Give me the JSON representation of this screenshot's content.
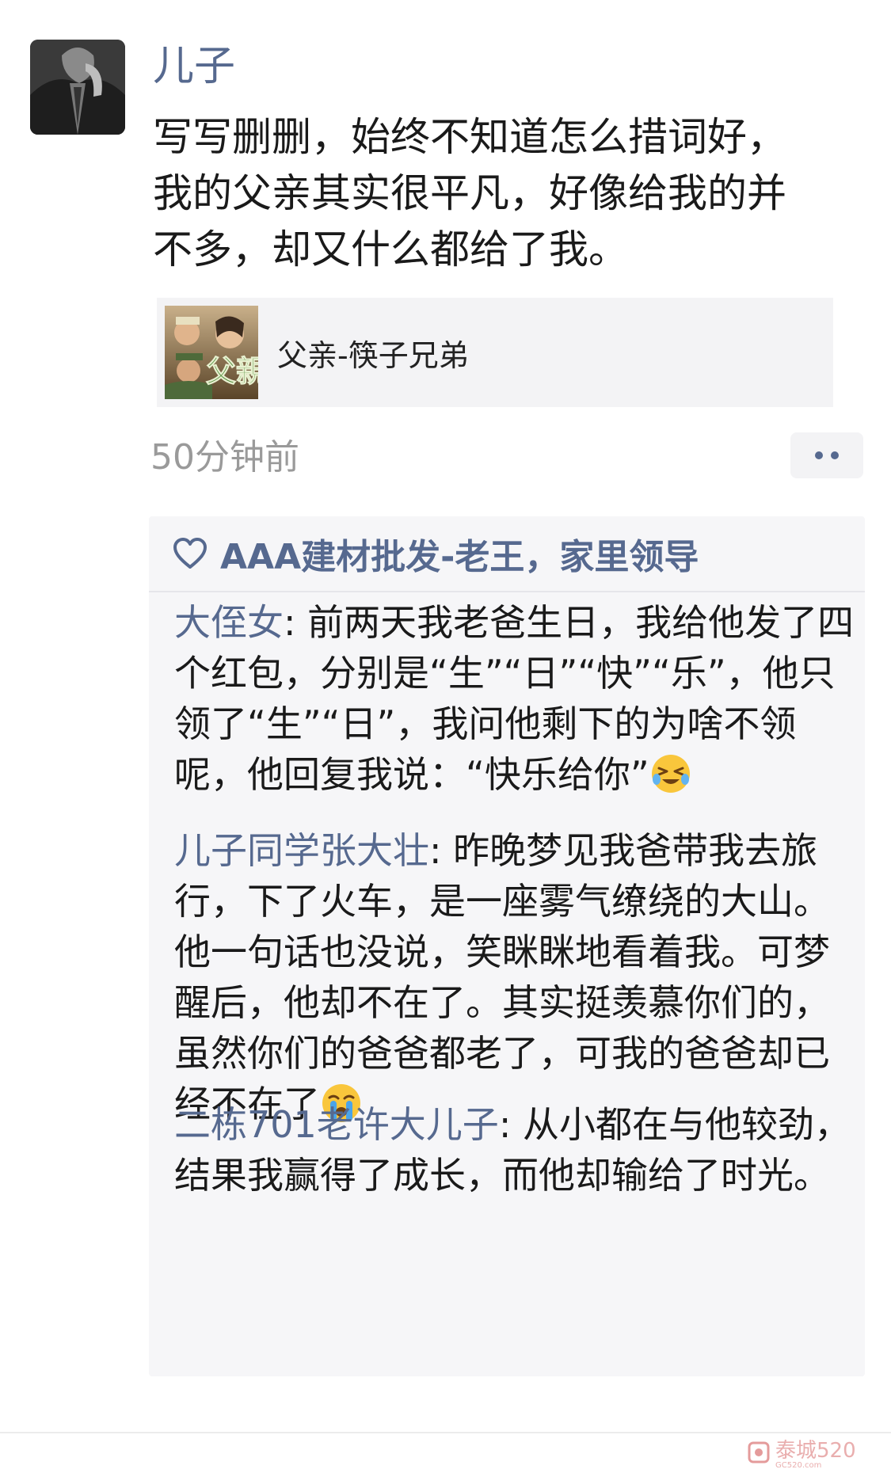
{
  "post": {
    "username": "儿子",
    "text": "写写删删，始终不知道怎么措词好，\n我的父亲其实很平凡，好像给我的并\n不多，却又什么都给了我。",
    "link_title": "父亲-筷子兄弟",
    "link_thumb_lettering": "父親",
    "timestamp": "50分钟前"
  },
  "likes": {
    "names": "AAA建材批发-老王，家里领导"
  },
  "comments": [
    {
      "author": "大侄女",
      "text": "前两天我老爸生日，我给他发了四个红包，分别是“生”“日”“快”“乐”，他只领了“生”“日”，我问他剩下的为啥不领呢，他回复我说：“快乐给你”",
      "emoji": "grinning-tears-emoji"
    },
    {
      "author": "儿子同学张大壮",
      "text": "昨晚梦见我爸带我去旅行，下了火车，是一座雾气缭绕的大山。他一句话也没说，笑眯眯地看着我。可梦醒后，他却不在了。其实挺羡慕你们的，虽然你们的爸爸都老了，可我的爸爸却已经不在了",
      "emoji": "crying-face-emoji"
    },
    {
      "author": "二栋701老许大儿子",
      "text": "从小都在与他较劲，结果我赢得了成长，而他却输给了时光。",
      "emoji": ""
    }
  ],
  "watermark": {
    "text": "泰城520",
    "small_text": "GC520.com"
  },
  "colors": {
    "name_blue": "#56698f",
    "timestamp_gray": "#9a9a9a",
    "panel_bg": "#f6f6f8"
  }
}
